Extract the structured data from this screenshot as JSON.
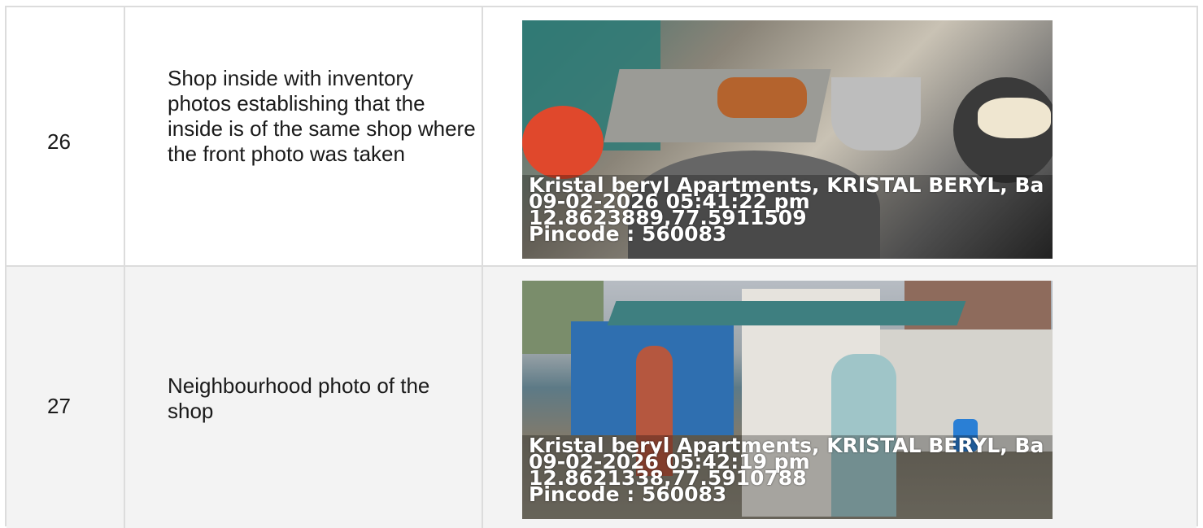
{
  "rows": [
    {
      "number": "26",
      "description": "Shop inside with inventory photos establishing that the inside is of the same shop where the front photo was taken",
      "photo_caption": {
        "line1": "Kristal beryl Apartments, KRISTAL BERYL, Ba",
        "line2": "09-02-2026 05:41:22 pm",
        "line3": "12.8623889,77.5911509",
        "line4": "Pincode : 560083"
      }
    },
    {
      "number": "27",
      "description": "Neighbourhood photo of the shop",
      "photo_caption": {
        "line1": "Kristal beryl Apartments, KRISTAL BERYL, Ba",
        "line2": "09-02-2026 05:42:19 pm",
        "line3": "12.8621338,77.5910788",
        "line4": "Pincode : 560083"
      }
    }
  ]
}
